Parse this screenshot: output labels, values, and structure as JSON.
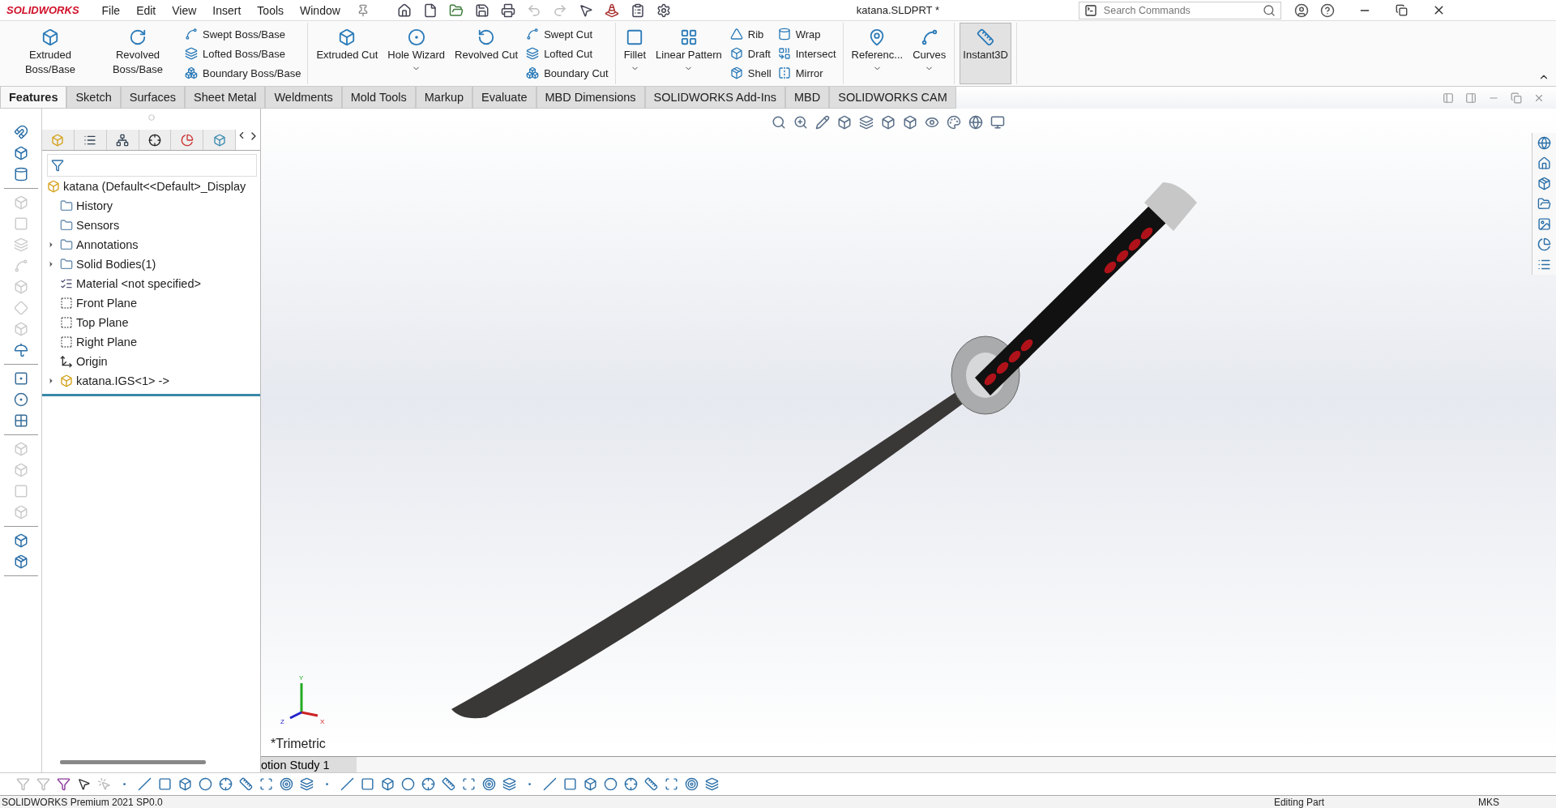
{
  "app": {
    "logo": "SOLIDWORKS",
    "menu": [
      "File",
      "Edit",
      "View",
      "Insert",
      "Tools",
      "Window"
    ],
    "document_title": "katana.SLDPRT *",
    "search": {
      "placeholder": "Search Commands"
    }
  },
  "ribbon": [
    {
      "items": [
        {
          "kind": "large",
          "label": "Extruded Boss/Base",
          "dropdown": false,
          "pressed": false
        },
        {
          "kind": "large",
          "label": "Revolved Boss/Base",
          "dropdown": false,
          "pressed": false
        },
        {
          "kind": "stack",
          "entries": [
            "Swept Boss/Base",
            "Lofted Boss/Base",
            "Boundary Boss/Base"
          ]
        }
      ]
    },
    {
      "items": [
        {
          "kind": "large",
          "label": "Extruded Cut",
          "dropdown": false,
          "pressed": false
        },
        {
          "kind": "large",
          "label": "Hole Wizard",
          "dropdown": true,
          "pressed": false
        },
        {
          "kind": "large",
          "label": "Revolved Cut",
          "dropdown": false,
          "pressed": false
        },
        {
          "kind": "stack",
          "entries": [
            "Swept Cut",
            "Lofted Cut",
            "Boundary Cut"
          ]
        }
      ]
    },
    {
      "items": [
        {
          "kind": "large",
          "label": "Fillet",
          "dropdown": true,
          "pressed": false
        },
        {
          "kind": "large",
          "label": "Linear Pattern",
          "dropdown": true,
          "pressed": false
        },
        {
          "kind": "stack",
          "entries": [
            "Rib",
            "Draft",
            "Shell"
          ]
        },
        {
          "kind": "stack",
          "entries": [
            "Wrap",
            "Intersect",
            "Mirror"
          ]
        }
      ]
    },
    {
      "items": [
        {
          "kind": "large",
          "label": "Referenc...",
          "dropdown": true,
          "pressed": false
        },
        {
          "kind": "large",
          "label": "Curves",
          "dropdown": true,
          "pressed": false
        }
      ]
    },
    {
      "items": [
        {
          "kind": "large",
          "label": "Instant3D",
          "dropdown": false,
          "pressed": true
        }
      ]
    }
  ],
  "tabs": [
    {
      "label": "Features",
      "selected": true
    },
    {
      "label": "Sketch",
      "selected": false
    },
    {
      "label": "Surfaces",
      "selected": false
    },
    {
      "label": "Sheet Metal",
      "selected": false
    },
    {
      "label": "Weldments",
      "selected": false
    },
    {
      "label": "Mold Tools",
      "selected": false
    },
    {
      "label": "Markup",
      "selected": false
    },
    {
      "label": "Evaluate",
      "selected": false
    },
    {
      "label": "MBD Dimensions",
      "selected": false
    },
    {
      "label": "SOLIDWORKS Add-Ins",
      "selected": false
    },
    {
      "label": "MBD",
      "selected": false
    },
    {
      "label": "SOLIDWORKS CAM",
      "selected": false
    }
  ],
  "feature_tree": {
    "root": "katana  (Default<<Default>_Display",
    "items": [
      {
        "label": "History",
        "kind": "folder",
        "expandable": false
      },
      {
        "label": "Sensors",
        "kind": "folder",
        "expandable": false
      },
      {
        "label": "Annotations",
        "kind": "folder",
        "expandable": true
      },
      {
        "label": "Solid Bodies(1)",
        "kind": "folder",
        "expandable": true
      },
      {
        "label": "Material <not specified>",
        "kind": "material",
        "expandable": false
      },
      {
        "label": "Front Plane",
        "kind": "plane",
        "expandable": false
      },
      {
        "label": "Top Plane",
        "kind": "plane",
        "expandable": false
      },
      {
        "label": "Right Plane",
        "kind": "plane",
        "expandable": false
      },
      {
        "label": "Origin",
        "kind": "origin",
        "expandable": false
      },
      {
        "label": "katana.IGS<1> ->",
        "kind": "part",
        "expandable": true
      }
    ]
  },
  "viewport": {
    "view_label": "*Trimetric",
    "triad": {
      "x": "X",
      "y": "Y",
      "z": "Z"
    }
  },
  "motion_tab": "otion Study 1",
  "status_bar": {
    "product": "SOLIDWORKS Premium 2021 SP0.0",
    "mode": "Editing Part",
    "units": "MKS"
  }
}
